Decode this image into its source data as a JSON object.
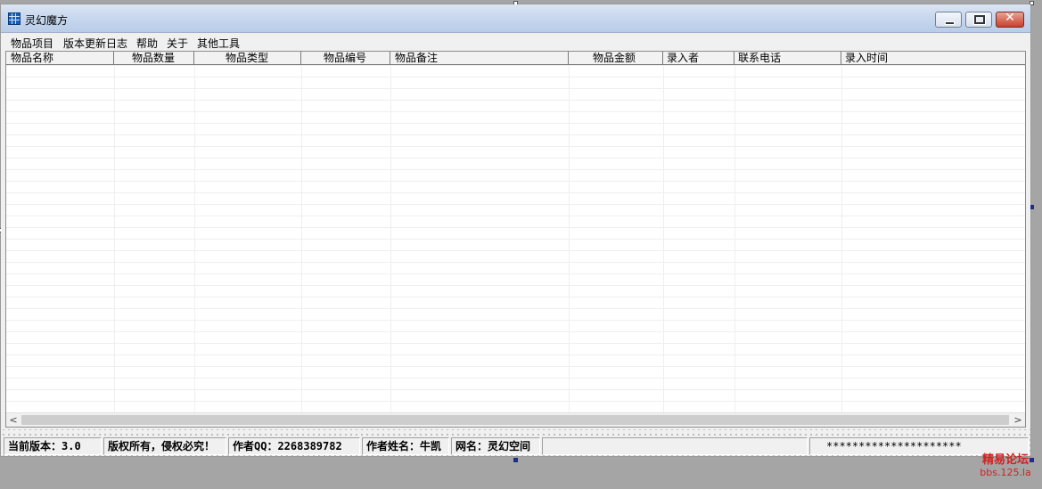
{
  "window": {
    "title": "灵幻魔方",
    "icon": "grid-app-icon",
    "controls": [
      "minimize",
      "maximize",
      "close"
    ]
  },
  "menu": {
    "items": [
      "物品项目",
      "版本更新日志",
      "帮助",
      "关于",
      "其他工具"
    ]
  },
  "grid": {
    "columns": [
      "物品名称",
      "物品数量",
      "物品类型",
      "物品编号",
      "物品备注",
      "物品金额",
      "录入者",
      "联系电话",
      "录入时间"
    ],
    "rows": []
  },
  "statusbar": {
    "version": "当前版本：3.0",
    "copyright": "版权所有，侵权必究！",
    "author_qq": "作者QQ：2268389782",
    "author_name": "作者姓名：牛凯",
    "net_name": "网名：灵幻空间",
    "empty": "",
    "stars": "*********************"
  },
  "watermark": {
    "line1": "精易论坛",
    "line2": "bbs.125.la"
  },
  "colors": {
    "titlebar": "#c8d8ee",
    "close_button": "#c7402a",
    "watermark": "#d32020"
  }
}
